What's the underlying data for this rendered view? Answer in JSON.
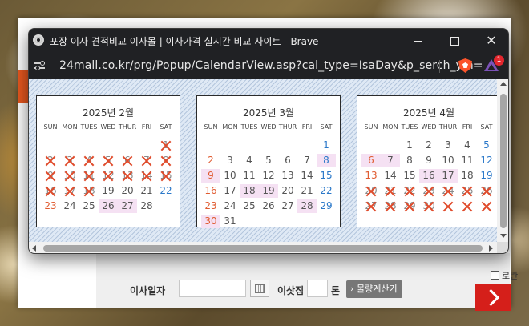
{
  "window": {
    "title": "포장 이사 견적비교 이사몰 | 이사가격 실시간 비교 사이트 - Brave",
    "url": "24mall.co.kr/prg/Popup/CalendarView.asp?cal_type=IsaDay&p_serch_ym=",
    "rewards_badge": "1"
  },
  "weekdays": [
    "SUN",
    "MON",
    "TUES",
    "WED",
    "THUR",
    "FRI",
    "SAT"
  ],
  "months": [
    {
      "title": "2025년 2월",
      "days": [
        {
          "d": "",
          "cls": ""
        },
        {
          "d": "",
          "cls": ""
        },
        {
          "d": "",
          "cls": ""
        },
        {
          "d": "",
          "cls": ""
        },
        {
          "d": "",
          "cls": ""
        },
        {
          "d": "",
          "cls": ""
        },
        {
          "d": "1",
          "cls": "sat x"
        },
        {
          "d": "2",
          "cls": "sun x"
        },
        {
          "d": "3",
          "cls": "x"
        },
        {
          "d": "4",
          "cls": "x"
        },
        {
          "d": "5",
          "cls": "x"
        },
        {
          "d": "6",
          "cls": "x"
        },
        {
          "d": "7",
          "cls": "x"
        },
        {
          "d": "8",
          "cls": "sat x"
        },
        {
          "d": "9",
          "cls": "sun x"
        },
        {
          "d": "10",
          "cls": "x"
        },
        {
          "d": "11",
          "cls": "x"
        },
        {
          "d": "12",
          "cls": "x"
        },
        {
          "d": "13",
          "cls": "x"
        },
        {
          "d": "14",
          "cls": "x"
        },
        {
          "d": "15",
          "cls": "sat x"
        },
        {
          "d": "16",
          "cls": "sun x"
        },
        {
          "d": "17",
          "cls": "x"
        },
        {
          "d": "18",
          "cls": "x"
        },
        {
          "d": "19",
          "cls": ""
        },
        {
          "d": "20",
          "cls": ""
        },
        {
          "d": "21",
          "cls": ""
        },
        {
          "d": "22",
          "cls": "sat"
        },
        {
          "d": "23",
          "cls": "sun"
        },
        {
          "d": "24",
          "cls": ""
        },
        {
          "d": "25",
          "cls": ""
        },
        {
          "d": "26",
          "cls": "hl"
        },
        {
          "d": "27",
          "cls": "hl"
        },
        {
          "d": "28",
          "cls": ""
        },
        {
          "d": "",
          "cls": ""
        }
      ]
    },
    {
      "title": "2025년 3월",
      "days": [
        {
          "d": "",
          "cls": ""
        },
        {
          "d": "",
          "cls": ""
        },
        {
          "d": "",
          "cls": ""
        },
        {
          "d": "",
          "cls": ""
        },
        {
          "d": "",
          "cls": ""
        },
        {
          "d": "",
          "cls": ""
        },
        {
          "d": "1",
          "cls": "sat"
        },
        {
          "d": "2",
          "cls": "sun"
        },
        {
          "d": "3",
          "cls": ""
        },
        {
          "d": "4",
          "cls": ""
        },
        {
          "d": "5",
          "cls": ""
        },
        {
          "d": "6",
          "cls": ""
        },
        {
          "d": "7",
          "cls": ""
        },
        {
          "d": "8",
          "cls": "sat hl"
        },
        {
          "d": "9",
          "cls": "sun hl"
        },
        {
          "d": "10",
          "cls": ""
        },
        {
          "d": "11",
          "cls": ""
        },
        {
          "d": "12",
          "cls": ""
        },
        {
          "d": "13",
          "cls": ""
        },
        {
          "d": "14",
          "cls": ""
        },
        {
          "d": "15",
          "cls": "sat"
        },
        {
          "d": "16",
          "cls": "sun"
        },
        {
          "d": "17",
          "cls": ""
        },
        {
          "d": "18",
          "cls": "hl"
        },
        {
          "d": "19",
          "cls": "hl"
        },
        {
          "d": "20",
          "cls": ""
        },
        {
          "d": "21",
          "cls": ""
        },
        {
          "d": "22",
          "cls": "sat"
        },
        {
          "d": "23",
          "cls": "sun"
        },
        {
          "d": "24",
          "cls": ""
        },
        {
          "d": "25",
          "cls": ""
        },
        {
          "d": "26",
          "cls": ""
        },
        {
          "d": "27",
          "cls": ""
        },
        {
          "d": "28",
          "cls": "hl"
        },
        {
          "d": "29",
          "cls": "sat"
        },
        {
          "d": "30",
          "cls": "sun hl"
        },
        {
          "d": "31",
          "cls": ""
        }
      ]
    },
    {
      "title": "2025년 4월",
      "days": [
        {
          "d": "",
          "cls": ""
        },
        {
          "d": "",
          "cls": ""
        },
        {
          "d": "1",
          "cls": ""
        },
        {
          "d": "2",
          "cls": ""
        },
        {
          "d": "3",
          "cls": ""
        },
        {
          "d": "4",
          "cls": ""
        },
        {
          "d": "5",
          "cls": "sat"
        },
        {
          "d": "6",
          "cls": "sun hl"
        },
        {
          "d": "7",
          "cls": "hl"
        },
        {
          "d": "8",
          "cls": ""
        },
        {
          "d": "9",
          "cls": ""
        },
        {
          "d": "10",
          "cls": ""
        },
        {
          "d": "11",
          "cls": ""
        },
        {
          "d": "12",
          "cls": "sat"
        },
        {
          "d": "13",
          "cls": "sun"
        },
        {
          "d": "14",
          "cls": ""
        },
        {
          "d": "15",
          "cls": ""
        },
        {
          "d": "16",
          "cls": "hl"
        },
        {
          "d": "17",
          "cls": "hl"
        },
        {
          "d": "18",
          "cls": ""
        },
        {
          "d": "19",
          "cls": "sat"
        },
        {
          "d": "20",
          "cls": "sun x"
        },
        {
          "d": "21",
          "cls": "x"
        },
        {
          "d": "22",
          "cls": "x"
        },
        {
          "d": "23",
          "cls": "x"
        },
        {
          "d": "24",
          "cls": "x"
        },
        {
          "d": "25",
          "cls": "x"
        },
        {
          "d": "26",
          "cls": "sat x"
        },
        {
          "d": "27",
          "cls": "sun x"
        },
        {
          "d": "28",
          "cls": "x"
        },
        {
          "d": "29",
          "cls": "x"
        },
        {
          "d": "30",
          "cls": "x"
        },
        {
          "d": "",
          "cls": "x"
        },
        {
          "d": "",
          "cls": "x"
        },
        {
          "d": "",
          "cls": "x"
        }
      ]
    }
  ],
  "background_page": {
    "move_date_label": "이사일자",
    "load_label": "이삿짐",
    "ton_label": "톤",
    "load_calc_button": "물량계산기",
    "ladder_label": "로란"
  }
}
